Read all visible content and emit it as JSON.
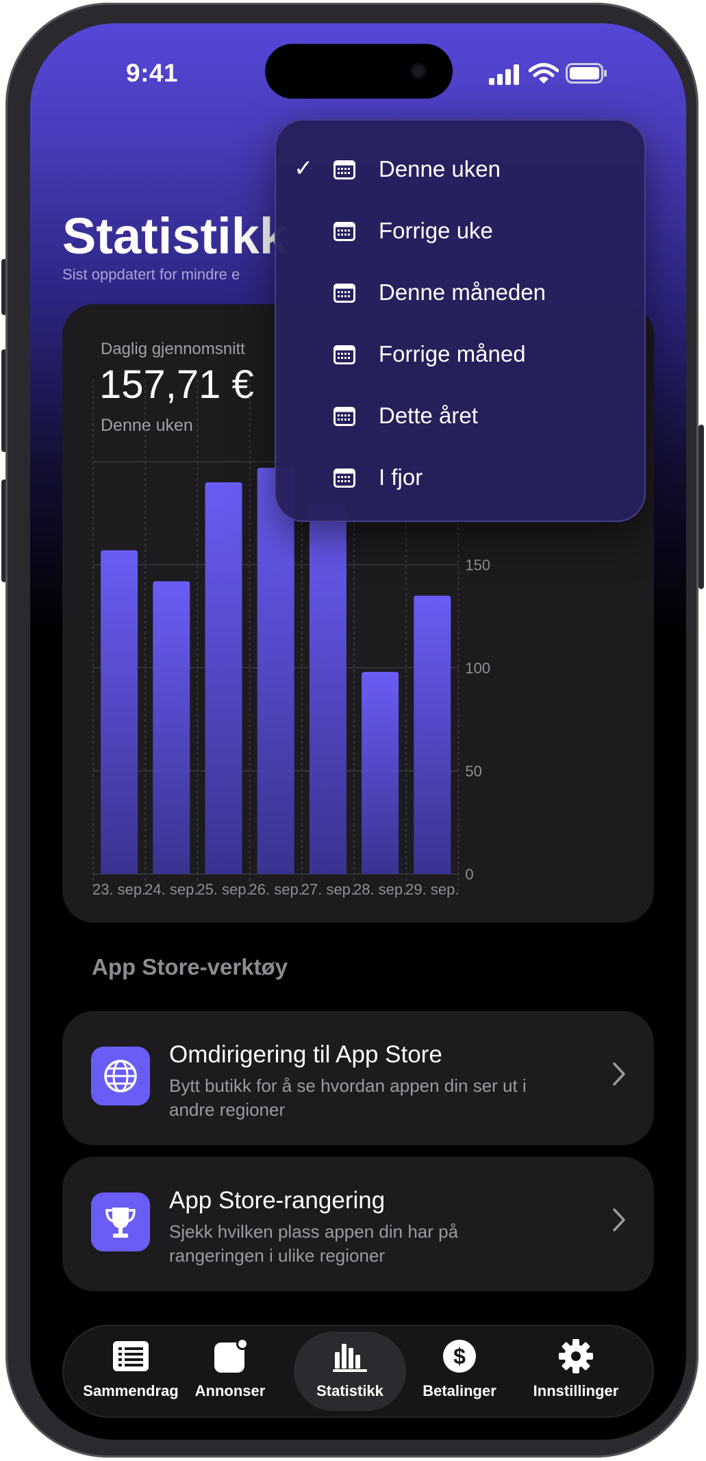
{
  "status_bar": {
    "time": "9:41"
  },
  "header": {
    "title": "Statistikk",
    "subtitle": "Sist oppdatert for mindre e"
  },
  "period_menu": {
    "selected_index": 0,
    "items": [
      {
        "label": "Denne uken",
        "checked": true,
        "icon": "calendar-icon"
      },
      {
        "label": "Forrige uke",
        "checked": false,
        "icon": "calendar-icon"
      },
      {
        "label": "Denne måneden",
        "checked": false,
        "icon": "calendar-icon"
      },
      {
        "label": "Forrige måned",
        "checked": false,
        "icon": "calendar-icon"
      },
      {
        "label": "Dette året",
        "checked": false,
        "icon": "calendar-icon"
      },
      {
        "label": "I fjor",
        "checked": false,
        "icon": "calendar-icon"
      }
    ],
    "check_mark": "✓"
  },
  "summary": {
    "label": "Daglig gjennomsnitt",
    "value": "157,71 €",
    "period": "Denne uken"
  },
  "chart_data": {
    "type": "bar",
    "categories": [
      "23. sep.",
      "24. sep.",
      "25. sep.",
      "26. sep.",
      "27. sep.",
      "28. sep.",
      "29. sep."
    ],
    "values": [
      157,
      142,
      190,
      197,
      179,
      98,
      135
    ],
    "yticks": [
      0,
      50,
      100,
      150
    ],
    "ylim": [
      0,
      200
    ],
    "y_axis_side": "right",
    "grid": true,
    "bar_color": "#6a5df5"
  },
  "tools": {
    "heading": "App Store-verktøy",
    "items": [
      {
        "title": "Omdirigering til App Store",
        "description": "Bytt butikk for å se hvordan appen din ser ut i andre regioner",
        "icon": "globe-icon"
      },
      {
        "title": "App Store-rangering",
        "description": "Sjekk hvilken plass appen din har på rangeringen i ulike regioner",
        "icon": "trophy-icon"
      }
    ]
  },
  "tabbar": {
    "active_index": 2,
    "items": [
      {
        "label": "Sammendrag",
        "icon": "list-icon"
      },
      {
        "label": "Annonser",
        "icon": "ads-icon"
      },
      {
        "label": "Statistikk",
        "icon": "chart-icon"
      },
      {
        "label": "Betalinger",
        "icon": "dollar-icon"
      },
      {
        "label": "Innstillinger",
        "icon": "gear-icon"
      }
    ]
  },
  "colors": {
    "accent": "#6a5df5",
    "header_gradient_top": "#5547d8",
    "card_background": "#1c1c1f"
  }
}
